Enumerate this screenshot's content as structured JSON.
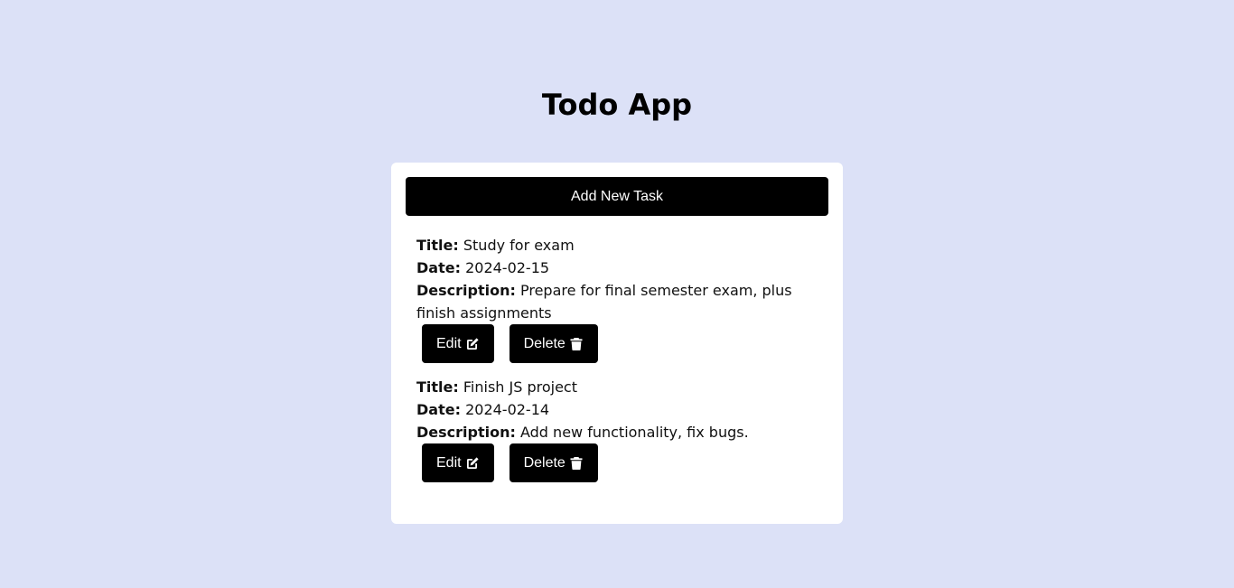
{
  "header": {
    "title": "Todo App"
  },
  "toolbar": {
    "add_label": "Add New Task"
  },
  "labels": {
    "title": "Title:",
    "date": "Date:",
    "description": "Description:",
    "edit": "Edit",
    "delete": "Delete"
  },
  "tasks": [
    {
      "title": "Study for exam",
      "date": "2024-02-15",
      "description": "Prepare for final semester exam, plus finish assignments"
    },
    {
      "title": "Finish JS project",
      "date": "2024-02-14",
      "description": "Add new functionality, fix bugs."
    }
  ],
  "icons": {
    "edit": "edit-icon",
    "delete": "trash-icon"
  },
  "colors": {
    "background": "#dce1f7",
    "card": "#ffffff",
    "button": "#000000",
    "button_text": "#ffffff"
  }
}
